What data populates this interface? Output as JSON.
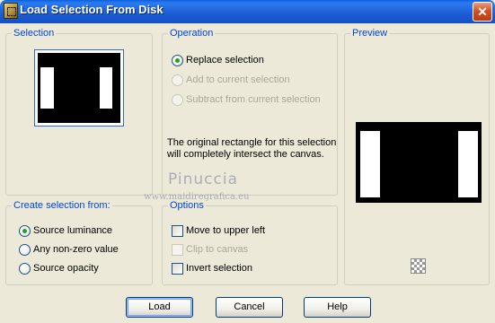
{
  "window": {
    "title": "Load Selection From Disk",
    "close_glyph": "✕"
  },
  "selection": {
    "label": "Selection"
  },
  "operation": {
    "label": "Operation",
    "options": [
      {
        "label": "Replace selection",
        "checked": true,
        "enabled": true
      },
      {
        "label": "Add to current selection",
        "checked": false,
        "enabled": false
      },
      {
        "label": "Subtract from current selection",
        "checked": false,
        "enabled": false
      }
    ],
    "info": "The original rectangle for this selection will completely intersect the canvas."
  },
  "preview": {
    "label": "Preview",
    "checker_icon": "transparency-checker-icon"
  },
  "create_from": {
    "label": "Create selection from:",
    "options": [
      {
        "label": "Source luminance",
        "checked": true
      },
      {
        "label": "Any non-zero value",
        "checked": false
      },
      {
        "label": "Source opacity",
        "checked": false
      }
    ]
  },
  "options": {
    "label": "Options",
    "items": [
      {
        "label": "Move to upper left",
        "checked": false,
        "enabled": true
      },
      {
        "label": "Clip to canvas",
        "checked": false,
        "enabled": false
      },
      {
        "label": "Invert selection",
        "checked": false,
        "enabled": true
      }
    ]
  },
  "watermark": {
    "line1": "Pinuccia",
    "line2": "www.maidiregrafica.eu"
  },
  "buttons": {
    "load": "Load",
    "cancel": "Cancel",
    "help": "Help"
  },
  "colors": {
    "titlebar": "#1D5FD6",
    "group_label": "#0046D5",
    "dialog_bg": "#ECE9D8"
  }
}
